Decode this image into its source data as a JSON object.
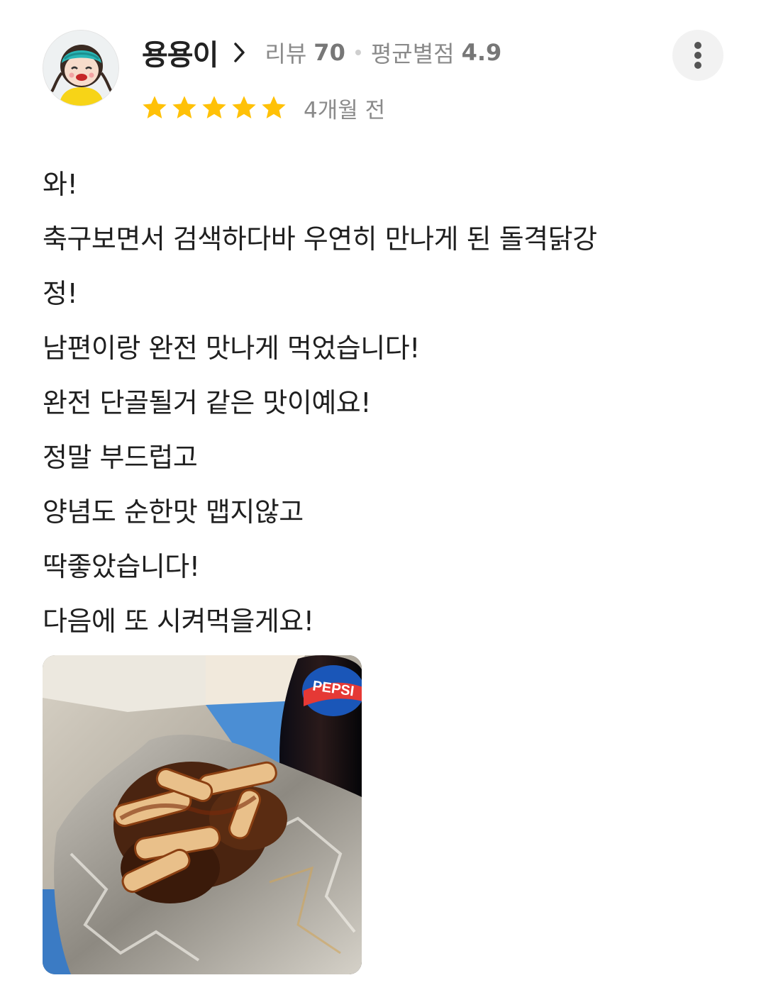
{
  "review": {
    "author": {
      "name": "용용이",
      "avatar_icon": "cartoon-avatar-icon",
      "review_count_label": "리뷰",
      "review_count": "70",
      "avg_rating_label": "평균별점",
      "avg_rating": "4.9"
    },
    "rating": 5,
    "rating_max": 5,
    "star_color": "#FFC107",
    "time_ago": "4개월 전",
    "more_icon": "more-vertical-icon",
    "lines": [
      "와!",
      "축구보면서 검색하다바 우연히 만나게 된 돌격닭강",
      "정!",
      "남편이랑 완전 맛나게 먹었습니다!",
      "완전 단골될거 같은 맛이예요!",
      "정말 부드럽고",
      "양념도 순한맛 맵지않고",
      "딱좋았습니다!",
      "다음에 또 시켜먹을게요!"
    ],
    "photo": {
      "bottle_label": "PEPSI"
    }
  }
}
